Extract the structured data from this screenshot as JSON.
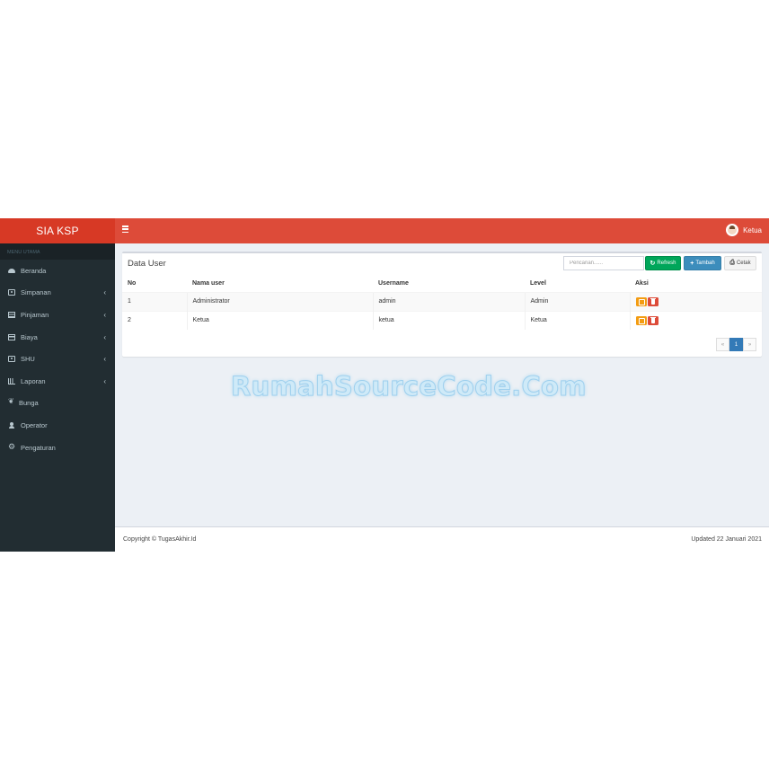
{
  "app": {
    "brand": "SIA KSP"
  },
  "header": {
    "user_name": "Ketua"
  },
  "sidebar": {
    "header": "MENU UTAMA",
    "items": [
      {
        "label": "Beranda",
        "icon": "dashboard-icon",
        "has_submenu": false
      },
      {
        "label": "Simpanan",
        "icon": "money-icon",
        "has_submenu": true
      },
      {
        "label": "Pinjaman",
        "icon": "table-icon",
        "has_submenu": true
      },
      {
        "label": "Biaya",
        "icon": "credit-card-icon",
        "has_submenu": true
      },
      {
        "label": "SHU",
        "icon": "money-icon",
        "has_submenu": true
      },
      {
        "label": "Laporan",
        "icon": "bar-chart-icon",
        "has_submenu": true
      },
      {
        "label": "Bunga",
        "icon": "flower-icon",
        "has_submenu": false
      },
      {
        "label": "Operator",
        "icon": "user-icon",
        "has_submenu": false
      },
      {
        "label": "Pengaturan",
        "icon": "gear-icon",
        "has_submenu": false
      }
    ]
  },
  "box": {
    "title": "Data User",
    "search_placeholder": "Pencarian......",
    "refresh_label": "Refresh",
    "add_label": "Tambah",
    "print_label": "Cetak"
  },
  "table": {
    "columns": [
      "No",
      "Nama user",
      "Username",
      "Level",
      "Aksi"
    ],
    "rows": [
      [
        "1",
        "Administrator",
        "admin",
        "Admin"
      ],
      [
        "2",
        "Ketua",
        "ketua",
        "Ketua"
      ]
    ]
  },
  "pagination": {
    "prev": "«",
    "current": "1",
    "next": "»"
  },
  "watermark": "RumahSourceCode.Com",
  "footer": {
    "copyright": "Copyright © TugasAkhir.Id",
    "updated": "Updated 22 Januari 2021"
  },
  "colors": {
    "topbar": "#dd4b39",
    "logo": "#d73925",
    "sidebar": "#222d32",
    "green": "#00a65a",
    "blue": "#3c8dbc"
  }
}
